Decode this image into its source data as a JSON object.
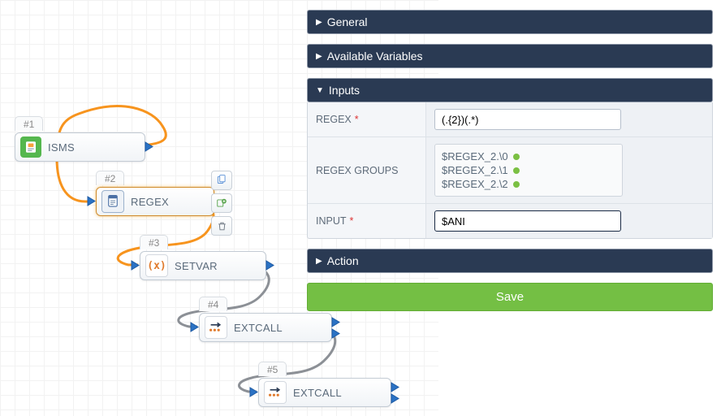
{
  "nodes": {
    "n1": {
      "tag": "#1",
      "label": "ISMS"
    },
    "n2": {
      "tag": "#2",
      "label": "REGEX"
    },
    "n3": {
      "tag": "#3",
      "label": "SETVAR"
    },
    "n4": {
      "tag": "#4",
      "label": "EXTCALL"
    },
    "n5": {
      "tag": "#5",
      "label": "EXTCALL"
    }
  },
  "panel": {
    "sections": {
      "general": "General",
      "vars": "Available Variables",
      "inputs": "Inputs",
      "action": "Action"
    },
    "fields": {
      "regex_label": "REGEX",
      "regex_value": "(.{2})(.*)",
      "groups_label": "REGEX GROUPS",
      "groups": [
        "$REGEX_2.\\0",
        "$REGEX_2.\\1",
        "$REGEX_2.\\2"
      ],
      "input_label": "INPUT",
      "input_value": "$ANI"
    },
    "save": "Save"
  },
  "icons": {
    "isms": "isms-icon",
    "regex": "regex-icon",
    "setvar": "setvar-icon",
    "extcall": "extcall-icon"
  }
}
